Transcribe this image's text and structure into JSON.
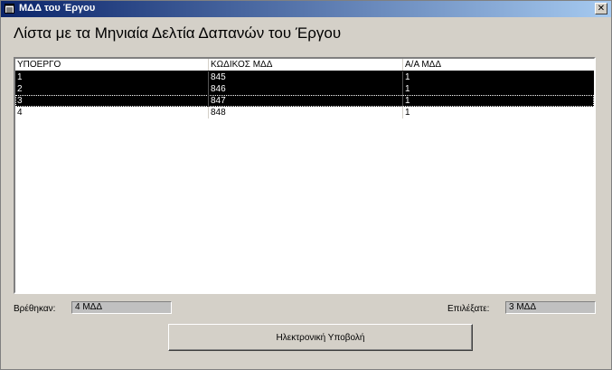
{
  "window": {
    "title": "ΜΔΔ του Έργου",
    "close_glyph": "✕"
  },
  "page_title": "Λίστα με τα Μηνιαία Δελτία Δαπανών του Έργου",
  "list": {
    "columns": [
      "ΥΠΟΕΡΓΟ",
      "ΚΩΔΙΚΟΣ ΜΔΔ",
      "Α/Α ΜΔΔ"
    ],
    "rows": [
      [
        "1",
        "845",
        "1"
      ],
      [
        "2",
        "846",
        "1"
      ],
      [
        "3",
        "847",
        "1"
      ],
      [
        "4",
        "848",
        "1"
      ]
    ],
    "selected_rows": [
      0,
      1,
      2
    ],
    "focused_row": 2
  },
  "found": {
    "label": "Βρέθηκαν:",
    "value": "4 ΜΔΔ"
  },
  "selected": {
    "label": "Επιλέξατε:",
    "value": "3 ΜΔΔ"
  },
  "submit_button": {
    "label": "Ηλεκτρονική Υποβολή"
  },
  "colors": {
    "selection_bg": "#000000",
    "selection_fg": "#ffffff",
    "dialog_bg": "#d4d0c8",
    "titlebar_start": "#0a246a",
    "titlebar_end": "#a6caf0"
  },
  "icons": {
    "window_icon": "form-icon",
    "close_icon": "close-icon"
  }
}
